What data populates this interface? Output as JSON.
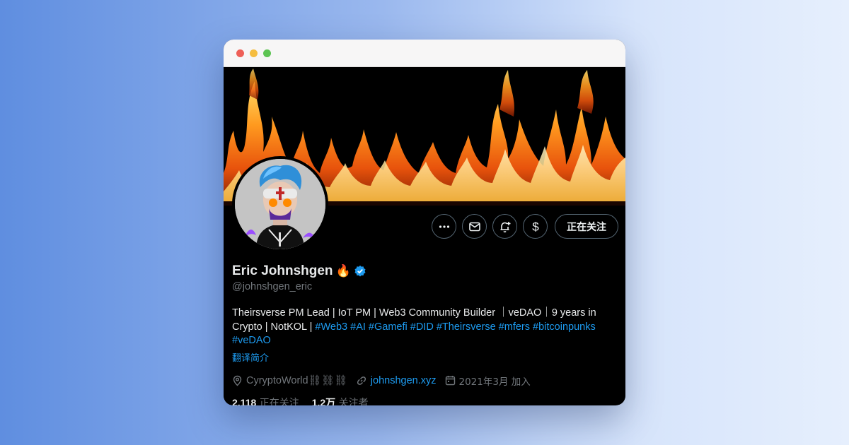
{
  "window": {
    "controls": [
      "close",
      "minimize",
      "maximize"
    ]
  },
  "profile": {
    "name": "Eric Johnshgen",
    "name_emoji": "🔥",
    "verified": true,
    "handle": "@johnshgen_eric",
    "bio_text_1": "Theirsverse PM Lead | IoT PM | Web3 Community Builder ｜veDAO｜9 years in Crypto | NotKOL | ",
    "hashtags": [
      "#Web3",
      "#AI",
      "#Gamefi",
      "#DID",
      "#Theirsverse",
      "#mfers",
      "#bitcoinpunks",
      "#veDAO"
    ],
    "translate_label": "翻译简介",
    "location": "CyryptoWorld⛓⛓⛓",
    "website": "johnshgen.xyz",
    "joined": "2021年3月 加入",
    "following_count": "2,118",
    "following_label": "正在关注",
    "followers_count": "1.2万",
    "followers_label": "关注者"
  },
  "actions": {
    "more_icon": "more-icon",
    "message_icon": "mail-icon",
    "notify_icon": "bell-plus-icon",
    "tip_icon": "dollar-icon",
    "follow_label": "正在关注"
  },
  "colors": {
    "accent": "#1d9bf0",
    "secondary_text": "#71767b",
    "primary_text": "#e7e9ea",
    "verified_badge": "#1d9bf0"
  }
}
